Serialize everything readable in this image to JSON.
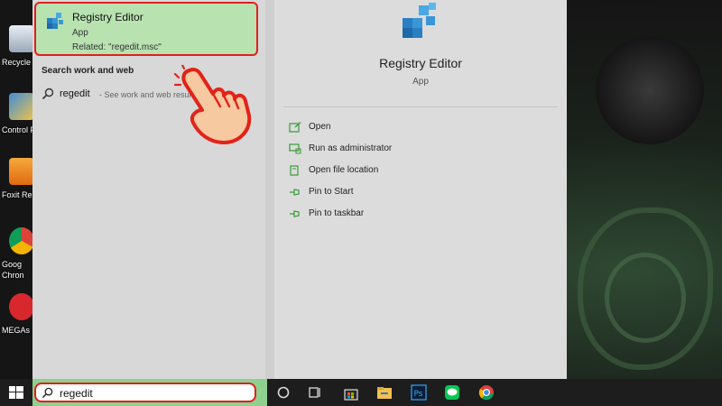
{
  "desktop": {
    "icons": [
      {
        "label": "Recycle",
        "icon": "recycle-bin-icon"
      },
      {
        "label": "Control P",
        "icon": "control-panel-icon"
      },
      {
        "label": "Foxit Re",
        "icon": "foxit-reader-icon"
      },
      {
        "label": "Goog",
        "icon": "google-chrome-icon",
        "label2": "Chron"
      },
      {
        "label": "MEGAs",
        "icon": "mega-sync-icon"
      }
    ]
  },
  "best_match": {
    "title": "Registry Editor",
    "type": "App",
    "related": "Related: \"regedit.msc\"",
    "icon": "registry-editor-icon"
  },
  "results": {
    "section_heading": "Search work and web",
    "web_query": "regedit",
    "web_hint": "- See work and web results"
  },
  "detail": {
    "title": "Registry Editor",
    "subtitle": "App",
    "actions": [
      {
        "label": "Open",
        "icon": "open-icon"
      },
      {
        "label": "Run as administrator",
        "icon": "run-as-admin-icon"
      },
      {
        "label": "Open file location",
        "icon": "file-location-icon"
      },
      {
        "label": "Pin to Start",
        "icon": "pin-icon"
      },
      {
        "label": "Pin to taskbar",
        "icon": "pin-icon"
      }
    ]
  },
  "taskbar": {
    "search_query": "regedit",
    "apps": [
      "cortana-icon",
      "task-view-icon",
      "store-icon",
      "file-explorer-icon",
      "photoshop-icon",
      "line-icon",
      "chrome-icon"
    ]
  },
  "colors": {
    "highlight": "#b8e3b0",
    "accent_red": "#e01e1e",
    "action_green": "#3a9a3a"
  }
}
